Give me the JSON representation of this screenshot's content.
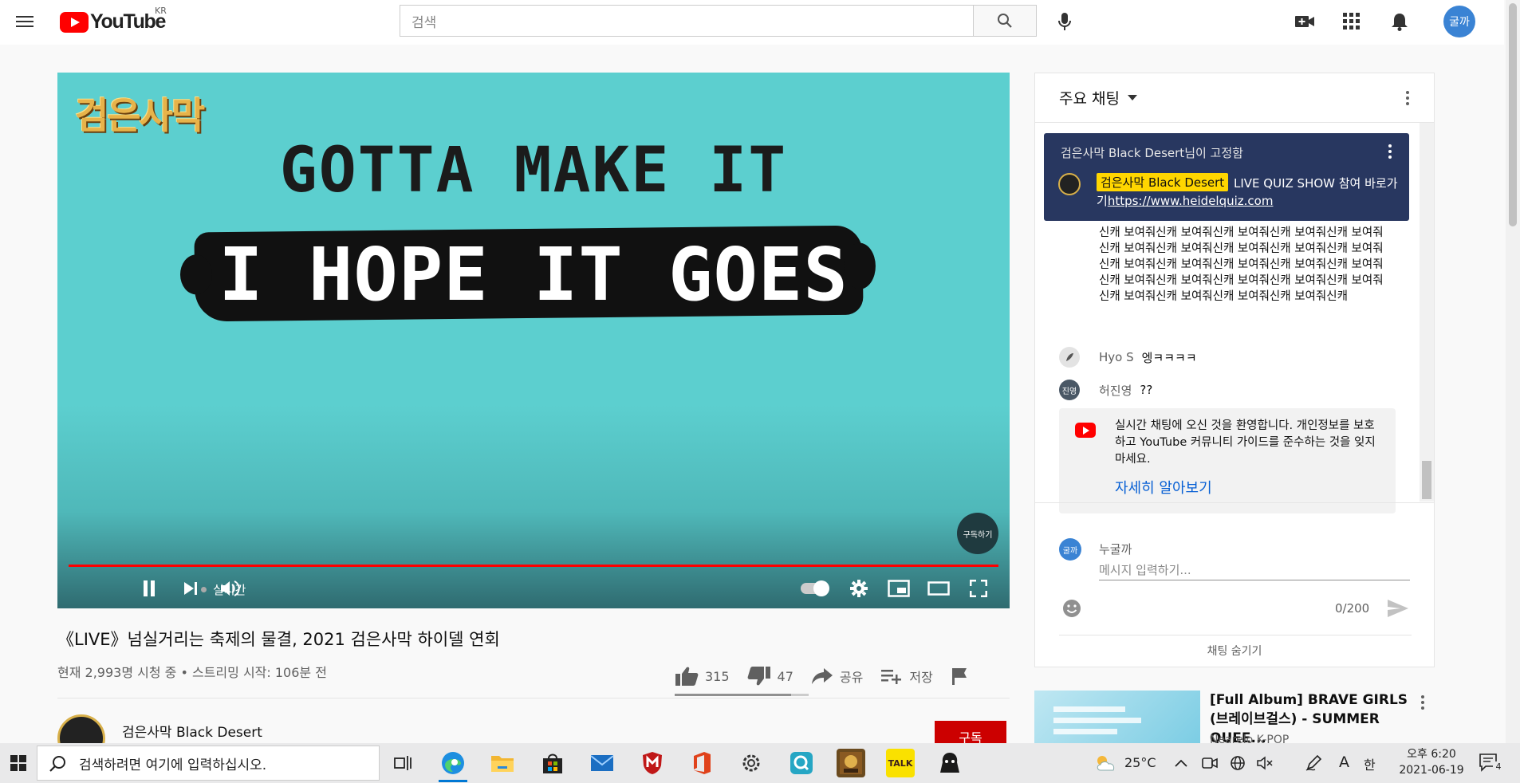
{
  "header": {
    "logo_text": "YouTube",
    "region": "KR",
    "search_placeholder": "검색",
    "avatar_text": "굴까"
  },
  "video": {
    "game_logo": "검은사막",
    "line1": "GOTTA MAKE IT",
    "line2": "I HOPE IT GOES",
    "mascot_text": "구독하기",
    "live_label": "실시간",
    "title": "《LIVE》넘실거리는 축제의 물결, 2021 검은사막 하이델 연회",
    "meta": "현재 2,993명 시청 중 • 스트리밍 시작: 106분 전",
    "likes": "315",
    "dislikes": "47",
    "share_label": "공유",
    "save_label": "저장",
    "like_ratio": 0.87,
    "channel_name": "검은사막 Black Desert",
    "subscribe_label": "구독"
  },
  "chat": {
    "header_title": "주요 채팅",
    "pinned": {
      "pinned_by": "검은사막 Black Desert님이 고정함",
      "author": "검은사막 Black Desert",
      "message": "LIVE QUIZ SHOW 참여 바로가기",
      "link": "https://www.heidelquiz.com"
    },
    "spam_message": "신캐 보여줘신캐 보여줘신캐 보여줘신캐 보여줘신캐 보여줘신캐 보여줘신캐 보여줘신캐 보여줘신캐 보여줘신캐 보여줘신캐 보여줘신캐 보여줘신캐 보여줘신캐 보여줘신캐 보여줘신캐 보여줘신캐 보여줘신캐 보여줘신캐 보여줘신캐 보여줘신캐 보여줘신캐 보여줘신캐 보여줘신캐 보여줘신캐",
    "messages": [
      {
        "author": "Hyo S",
        "text": "엥ㅋㅋㅋㅋ"
      },
      {
        "author": "허진영",
        "avatar": "진영",
        "text": "??"
      }
    ],
    "welcome_text": "실시간 채팅에 오신 것을 환영합니다. 개인정보를 보호하고 YouTube 커뮤니티 가이드를 준수하는 것을 잊지 마세요.",
    "welcome_link": "자세히 알아보기",
    "input_avatar": "굴까",
    "input_name": "누굴까",
    "input_placeholder": "메시지 입력하기...",
    "counter": "0/200",
    "hide_label": "채팅 숨기기"
  },
  "recommendation": {
    "title": "[Full Album] BRAVE GIRLS (브레이브걸스) - SUMMER QUEE...",
    "channel": "Nearelo K-POP"
  },
  "taskbar": {
    "search_placeholder": "검색하려면 여기에 입력하십시오.",
    "temperature": "25°C",
    "ime_letter": "A",
    "ime_lang": "한",
    "time": "오후 6:20",
    "date": "2021-06-19",
    "notification_count": "4",
    "talk_label": "TALK"
  },
  "colors": {
    "accent_red": "#ff0000",
    "pinned_bg": "#283760",
    "owner_chip": "#ffd600",
    "link_blue": "#065fd4",
    "video_bg": "#5ccfcf"
  }
}
